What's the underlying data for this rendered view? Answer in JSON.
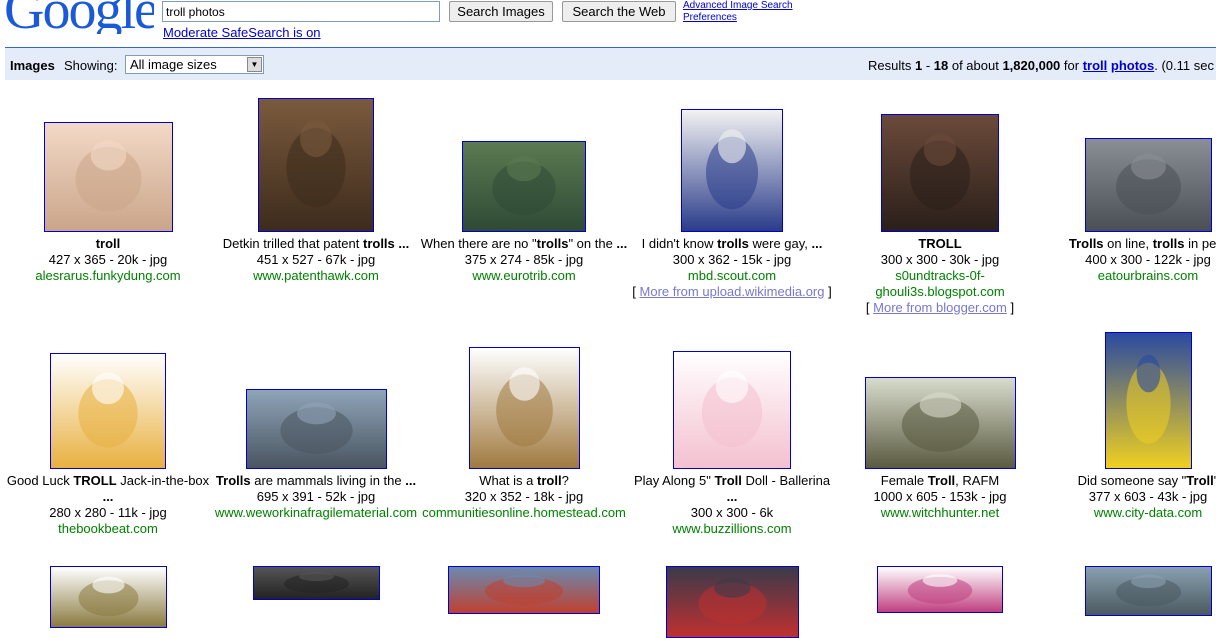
{
  "header": {
    "logo_text": "Google",
    "query": "troll photos",
    "search_images_label": "Search Images",
    "search_web_label": "Search the Web",
    "advanced_link": "Advanced Image Search",
    "preferences_link": "Preferences",
    "safesearch_link": "Moderate SafeSearch is on"
  },
  "bar": {
    "section_label": "Images",
    "showing_label": "Showing:",
    "size_option": "All image sizes",
    "results_prefix": "Results ",
    "range_start": "1",
    "range_sep": " - ",
    "range_end": "18",
    "of_about": " of about ",
    "total": "1,820,000",
    "for_word": " for ",
    "term1": "troll",
    "term2": "photos",
    "time_text": ". (0.11 sec"
  },
  "results": [
    {
      "cap_html": "<b>troll</b>",
      "meta": "427 x 365 - 20k - jpg",
      "site": "alesrarus.funkydung.com",
      "colors": [
        "#f3d9c6",
        "#caa58a"
      ]
    },
    {
      "cap_html": "Detkin trilled that patent <b>trolls ...</b>",
      "meta": "451 x 527 - 67k - jpg",
      "site": "www.patenthawk.com",
      "colors": [
        "#7a5a3d",
        "#3d2b1c"
      ]
    },
    {
      "cap_html": "When there are no \"<b>trolls</b>\" on the <b>...</b>",
      "meta": "375 x 274 - 85k - jpg",
      "site": "www.eurotrib.com",
      "colors": [
        "#5c7a52",
        "#2f4a35"
      ]
    },
    {
      "cap_html": "I didn't know <b>trolls</b> were gay, <b>...</b>",
      "meta": "300 x 362 - 15k - jpg",
      "site": "mbd.scout.com",
      "more": "More from upload.wikimedia.org",
      "colors": [
        "#f2f2f2",
        "#2a3c8a"
      ]
    },
    {
      "cap_html": "<b>TROLL</b>",
      "meta": "300 x 300 - 30k - jpg",
      "site": "s0undtracks-0f-",
      "site2": "ghouli3s.blogspot.com",
      "more": "More from blogger.com",
      "colors": [
        "#6b4a3a",
        "#2a1f1a"
      ]
    },
    {
      "cap_html": "<b>Trolls</b> on line, <b>trolls</b> in pers",
      "meta": "400 x 300 - 122k - jpg",
      "site": "eatourbrains.com",
      "colors": [
        "#8a8f95",
        "#4a4f55"
      ]
    },
    {
      "cap_html": "Good Luck <b>TROLL</b> Jack-in-the-box",
      "cap2": "...",
      "meta": "280 x 280 - 11k - jpg",
      "site": "thebookbeat.com",
      "colors": [
        "#ffffff",
        "#e8b040"
      ]
    },
    {
      "cap_html": "<b>Trolls</b> are mammals living in the <b>...</b>",
      "meta": "695 x 391 - 52k - jpg",
      "site": "www.weworkinafragilematerial.com",
      "colors": [
        "#8fa4b8",
        "#4a5560"
      ]
    },
    {
      "cap_html": "What is a <b>troll</b>?",
      "meta": "320 x 352 - 18k - jpg",
      "site": "communitiesonline.homestead.com",
      "colors": [
        "#ffffff",
        "#a07a40"
      ]
    },
    {
      "cap_html": "Play Along 5\" <b>Troll</b> Doll - Ballerina",
      "cap2": "...",
      "meta": "300 x 300 - 6k",
      "site": "www.buzzillions.com",
      "colors": [
        "#ffffff",
        "#f4c0d0"
      ]
    },
    {
      "cap_html": "Female <b>Troll</b>, RAFM",
      "meta": "1000 x 605 - 153k - jpg",
      "site": "www.witchhunter.net",
      "colors": [
        "#d8dccc",
        "#5a5a40"
      ]
    },
    {
      "cap_html": "Did someone say \"<b>Troll</b>\"",
      "meta": "377 x 603 - 43k - jpg",
      "site": "www.city-data.com",
      "colors": [
        "#2a4aa0",
        "#f0d020"
      ]
    },
    {
      "colors": [
        "#ffffff",
        "#8a7a40"
      ]
    },
    {
      "colors": [
        "#555555",
        "#222222"
      ]
    },
    {
      "colors": [
        "#6a8ab0",
        "#c04030"
      ]
    },
    {
      "colors": [
        "#3a3a4a",
        "#c03030"
      ]
    },
    {
      "colors": [
        "#ffffff",
        "#c04080"
      ]
    },
    {
      "colors": [
        "#8aa0b0",
        "#4a5a60"
      ]
    }
  ]
}
